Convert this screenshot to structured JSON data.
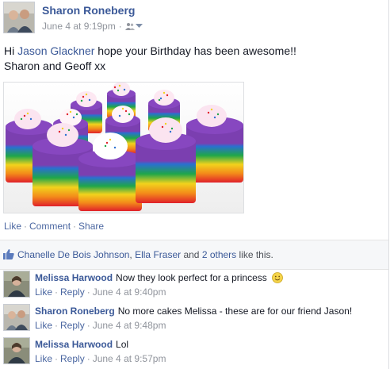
{
  "post": {
    "author": "Sharon Roneberg",
    "timestamp": "June 4 at 9:19pm",
    "separator": "·",
    "audience_icon": "friends-icon",
    "text_greeting": "Hi ",
    "text_tag": "Jason Glackner",
    "text_rest": " hope your Birthday has been awesome!!",
    "text_line2": "Sharon and Geoff xx",
    "photo_subject": "rainbow-layer-jelly-cakes-photo"
  },
  "actions": {
    "like": "Like",
    "comment": "Comment",
    "share": "Share",
    "sep": "·"
  },
  "likes": {
    "name1": "Chanelle De Bois Johnson",
    "comma": ", ",
    "name2": "Ella Fraser",
    "and": " and ",
    "others": "2 others",
    "suffix": " like this."
  },
  "comments": [
    {
      "name": "Melissa Harwood",
      "text": "Now they look perfect for a princess",
      "like": "Like",
      "reply": "Reply",
      "time": "June 4 at 9:40pm",
      "emoji": "smiley-emoji"
    },
    {
      "name": "Sharon Roneberg",
      "text": "No more cakes Melissa - these are for our friend Jason!",
      "like": "Like",
      "reply": "Reply",
      "time": "June 4 at 9:48pm"
    },
    {
      "name": "Melissa Harwood",
      "text": "Lol",
      "like": "Like",
      "reply": "Reply",
      "time": "June 4 at 9:57pm"
    }
  ],
  "comment_sep": "·",
  "colors": {
    "link": "#3b5998",
    "muted": "#90949c",
    "action": "#4b67a1",
    "text": "#141823"
  }
}
